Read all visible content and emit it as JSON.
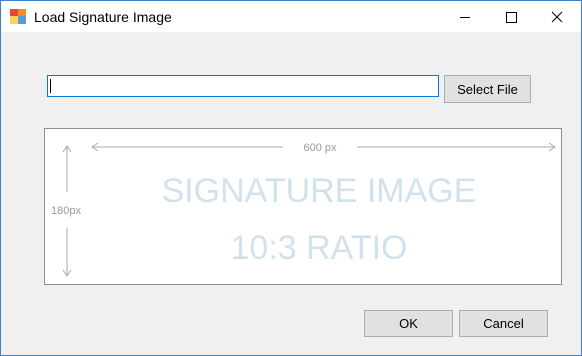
{
  "window": {
    "title": "Load Signature Image",
    "icon": "app-icon",
    "controls": [
      "minimize-icon",
      "maximize-icon",
      "close-icon"
    ]
  },
  "file_path": {
    "value": "",
    "placeholder": ""
  },
  "buttons": {
    "select_file": "Select File",
    "ok": "OK",
    "cancel": "Cancel"
  },
  "preview": {
    "width_label": "600 px",
    "height_label": "180px",
    "line1": "SIGNATURE IMAGE",
    "line2": "10:3 RATIO"
  },
  "colors": {
    "accent": "#0078d7",
    "watermark": "#d2e2ed",
    "dimension": "#999999"
  }
}
